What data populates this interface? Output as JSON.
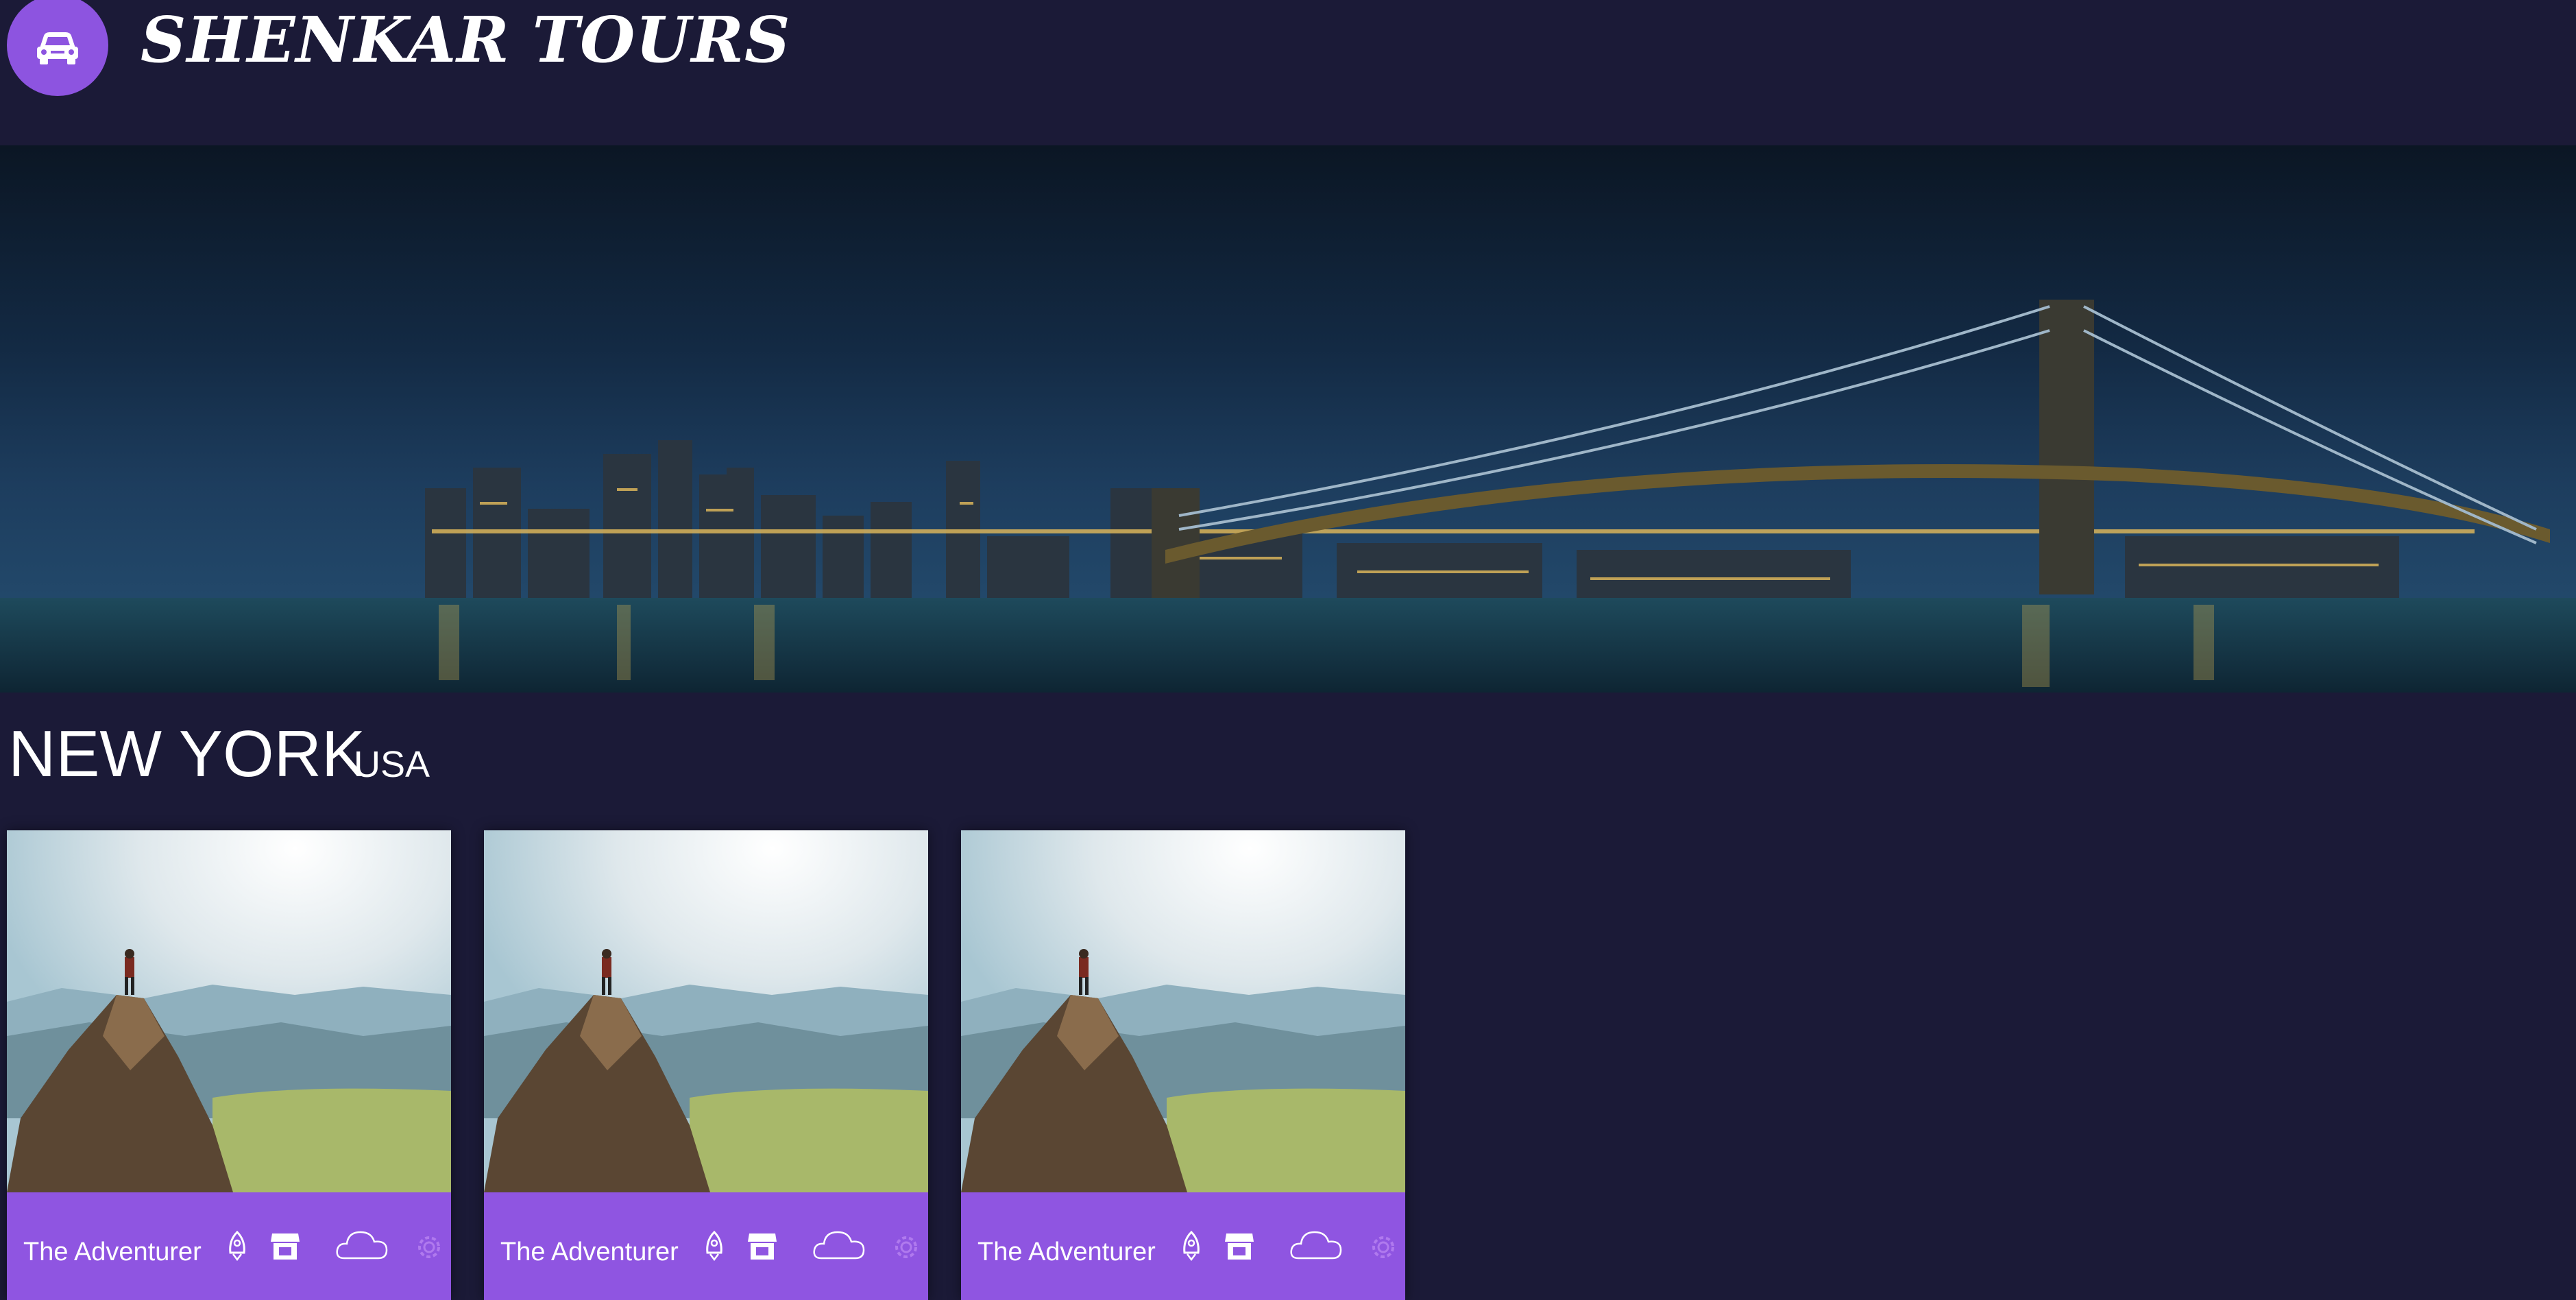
{
  "header": {
    "brand": "SHENKAR TOURS",
    "logo_icon": "car-icon",
    "logo_color": "#8d54e0"
  },
  "hero": {
    "image": "new-york-brooklyn-bridge-night-skyline"
  },
  "destination": {
    "city": "NEW YORK",
    "country": "USA"
  },
  "cards": [
    {
      "title": "The Adventurer",
      "image": "hiker-on-mountain-peak",
      "icons": [
        "rocket-icon",
        "store-icon",
        "cloud-icon",
        "gear-icon"
      ]
    },
    {
      "title": "The Adventurer",
      "image": "hiker-on-mountain-peak",
      "icons": [
        "rocket-icon",
        "store-icon",
        "cloud-icon",
        "gear-icon"
      ]
    },
    {
      "title": "The Adventurer",
      "image": "hiker-on-mountain-peak",
      "icons": [
        "rocket-icon",
        "store-icon",
        "cloud-icon",
        "gear-icon"
      ]
    }
  ],
  "colors": {
    "background": "#1b1a37",
    "accent": "#8f55e1",
    "text": "#ffffff"
  }
}
